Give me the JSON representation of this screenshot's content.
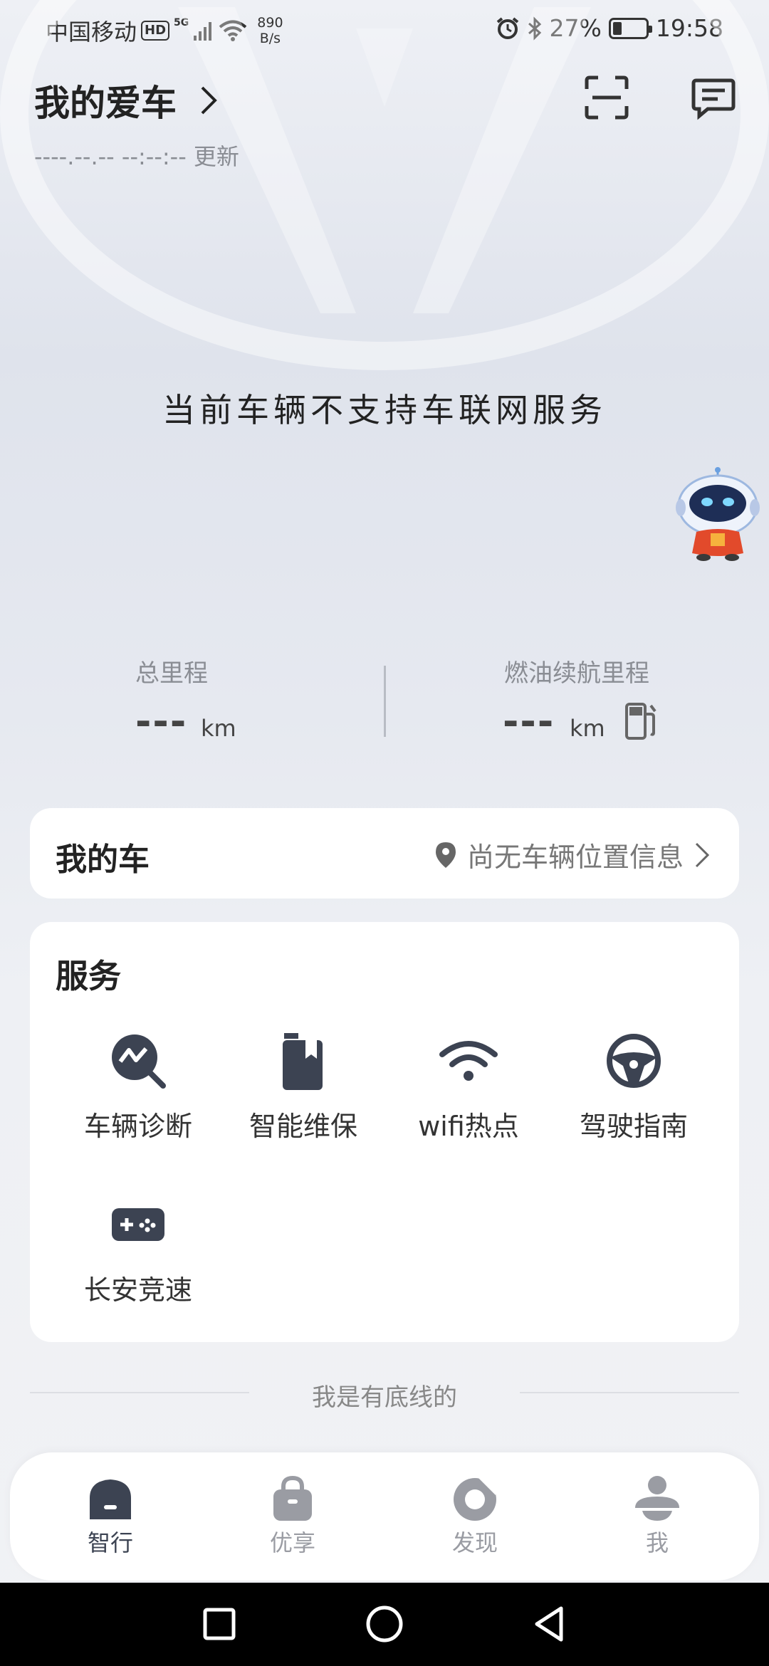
{
  "status_bar": {
    "carrier": "中国移动",
    "hd": "HD",
    "network": "5G",
    "speed_value": "890",
    "speed_unit": "B/s",
    "battery": "27%",
    "battery_level": 0.27,
    "time": "19:58"
  },
  "header": {
    "title": "我的爱车",
    "update_text": "----.--.-- --:--:-- 更新",
    "scan_icon": "scan-icon",
    "message_icon": "message-icon"
  },
  "vehicle": {
    "not_supported": "当前车辆不支持车联网服务"
  },
  "stats": {
    "total_mileage_label": "总里程",
    "total_mileage_value": "---",
    "total_mileage_unit": "km",
    "fuel_range_label": "燃油续航里程",
    "fuel_range_value": "---",
    "fuel_range_unit": "km"
  },
  "my_car": {
    "title": "我的车",
    "location": "尚无车辆位置信息"
  },
  "services": {
    "title": "服务",
    "items": [
      {
        "label": "车辆诊断",
        "icon": "diagnosis-icon"
      },
      {
        "label": "智能维保",
        "icon": "maintenance-icon"
      },
      {
        "label": "wifi热点",
        "icon": "wifi-icon"
      },
      {
        "label": "驾驶指南",
        "icon": "steering-wheel-icon"
      },
      {
        "label": "长安竞速",
        "icon": "gamepad-icon"
      }
    ]
  },
  "footer_text": "我是有底线的",
  "tabs": [
    {
      "label": "智行",
      "icon": "home-icon",
      "active": true
    },
    {
      "label": "优享",
      "icon": "bag-icon",
      "active": false
    },
    {
      "label": "发现",
      "icon": "discover-icon",
      "active": false
    },
    {
      "label": "我",
      "icon": "profile-icon",
      "active": false
    }
  ],
  "colors": {
    "active_tab": "#3c4352",
    "inactive_tab": "#9a9ca3",
    "icon_dark": "#3c4352"
  }
}
